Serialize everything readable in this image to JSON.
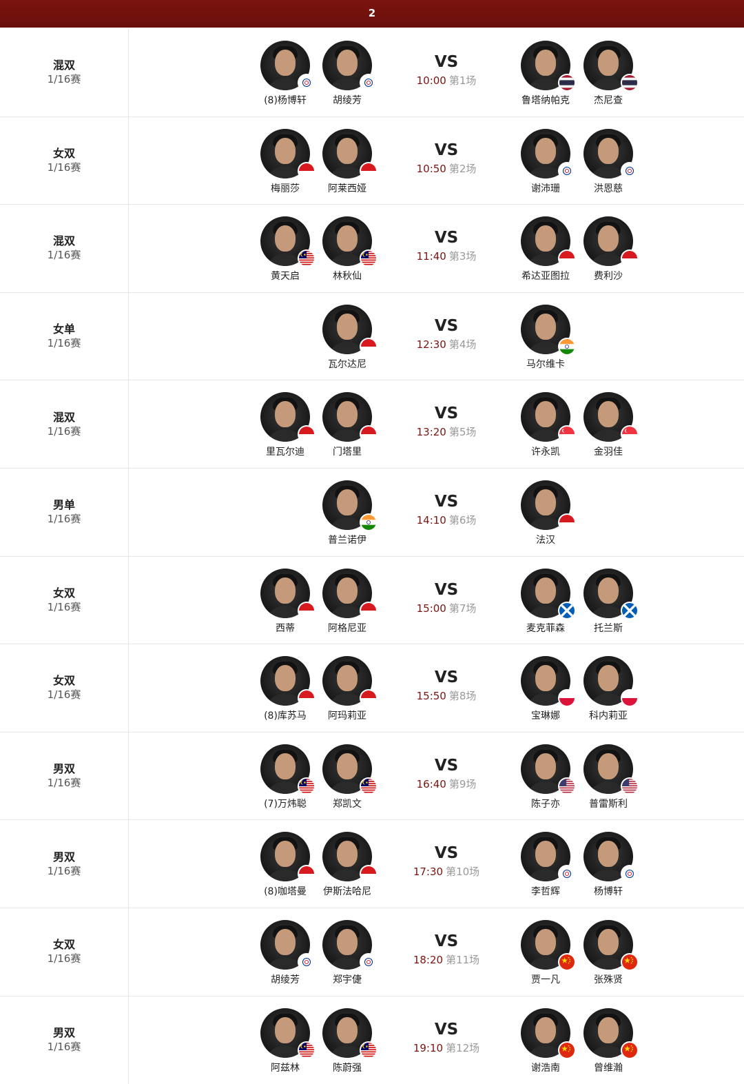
{
  "header": {
    "title": "2"
  },
  "matches": [
    {
      "event": "混双",
      "round": "1/16赛",
      "time": "10:00",
      "court": "第1场",
      "left": [
        {
          "name": "(8)杨博轩",
          "flag": "chinese-taipei"
        },
        {
          "name": "胡绫芳",
          "flag": "chinese-taipei"
        }
      ],
      "right": [
        {
          "name": "鲁塔纳帕克",
          "flag": "thailand"
        },
        {
          "name": "杰尼查",
          "flag": "thailand"
        }
      ]
    },
    {
      "event": "女双",
      "round": "1/16赛",
      "time": "10:50",
      "court": "第2场",
      "left": [
        {
          "name": "梅丽莎",
          "flag": "indonesia"
        },
        {
          "name": "阿莱西娅",
          "flag": "indonesia"
        }
      ],
      "right": [
        {
          "name": "谢沛珊",
          "flag": "chinese-taipei"
        },
        {
          "name": "洪恩慈",
          "flag": "chinese-taipei"
        }
      ]
    },
    {
      "event": "混双",
      "round": "1/16赛",
      "time": "11:40",
      "court": "第3场",
      "left": [
        {
          "name": "黄天启",
          "flag": "malaysia"
        },
        {
          "name": "林秋仙",
          "flag": "malaysia"
        }
      ],
      "right": [
        {
          "name": "希达亚图拉",
          "flag": "indonesia"
        },
        {
          "name": "费利沙",
          "flag": "indonesia"
        }
      ]
    },
    {
      "event": "女单",
      "round": "1/16赛",
      "time": "12:30",
      "court": "第4场",
      "left": [
        {
          "name": "瓦尔达尼",
          "flag": "indonesia"
        }
      ],
      "right": [
        {
          "name": "马尔维卡",
          "flag": "india"
        }
      ]
    },
    {
      "event": "混双",
      "round": "1/16赛",
      "time": "13:20",
      "court": "第5场",
      "left": [
        {
          "name": "里瓦尔迪",
          "flag": "indonesia"
        },
        {
          "name": "门塔里",
          "flag": "indonesia"
        }
      ],
      "right": [
        {
          "name": "许永凯",
          "flag": "singapore"
        },
        {
          "name": "金羽佳",
          "flag": "singapore"
        }
      ]
    },
    {
      "event": "男单",
      "round": "1/16赛",
      "time": "14:10",
      "court": "第6场",
      "left": [
        {
          "name": "普兰诺伊",
          "flag": "india"
        }
      ],
      "right": [
        {
          "name": "法汉",
          "flag": "indonesia"
        }
      ]
    },
    {
      "event": "女双",
      "round": "1/16赛",
      "time": "15:00",
      "court": "第7场",
      "left": [
        {
          "name": "西蒂",
          "flag": "indonesia"
        },
        {
          "name": "阿格尼亚",
          "flag": "indonesia"
        }
      ],
      "right": [
        {
          "name": "麦克菲森",
          "flag": "scotland"
        },
        {
          "name": "托兰斯",
          "flag": "scotland"
        }
      ]
    },
    {
      "event": "女双",
      "round": "1/16赛",
      "time": "15:50",
      "court": "第8场",
      "left": [
        {
          "name": "(8)库苏马",
          "flag": "indonesia"
        },
        {
          "name": "阿玛莉亚",
          "flag": "indonesia"
        }
      ],
      "right": [
        {
          "name": "宝琳娜",
          "flag": "poland"
        },
        {
          "name": "科内莉亚",
          "flag": "poland"
        }
      ]
    },
    {
      "event": "男双",
      "round": "1/16赛",
      "time": "16:40",
      "court": "第9场",
      "left": [
        {
          "name": "(7)万炜聪",
          "flag": "malaysia"
        },
        {
          "name": "郑凯文",
          "flag": "malaysia"
        }
      ],
      "right": [
        {
          "name": "陈子亦",
          "flag": "usa"
        },
        {
          "name": "普雷斯利",
          "flag": "usa"
        }
      ]
    },
    {
      "event": "男双",
      "round": "1/16赛",
      "time": "17:30",
      "court": "第10场",
      "left": [
        {
          "name": "(8)咖塔曼",
          "flag": "indonesia"
        },
        {
          "name": "伊斯法哈尼",
          "flag": "indonesia"
        }
      ],
      "right": [
        {
          "name": "李哲辉",
          "flag": "chinese-taipei"
        },
        {
          "name": "杨博轩",
          "flag": "chinese-taipei"
        }
      ]
    },
    {
      "event": "女双",
      "round": "1/16赛",
      "time": "18:20",
      "court": "第11场",
      "left": [
        {
          "name": "胡绫芳",
          "flag": "chinese-taipei"
        },
        {
          "name": "郑宇倢",
          "flag": "chinese-taipei"
        }
      ],
      "right": [
        {
          "name": "贾一凡",
          "flag": "china"
        },
        {
          "name": "张殊贤",
          "flag": "china"
        }
      ]
    },
    {
      "event": "男双",
      "round": "1/16赛",
      "time": "19:10",
      "court": "第12场",
      "left": [
        {
          "name": "阿兹林",
          "flag": "malaysia"
        },
        {
          "name": "陈蔚强",
          "flag": "malaysia"
        }
      ],
      "right": [
        {
          "name": "谢浩南",
          "flag": "china"
        },
        {
          "name": "曾维瀚",
          "flag": "china"
        }
      ]
    }
  ],
  "vs_label": "VS",
  "flag_colors": {
    "indonesia": [
      "#d71920",
      "#ffffff"
    ],
    "malaysia": [
      "#cc0001",
      "#ffffff",
      "#010066",
      "#ffcc00"
    ],
    "thailand": [
      "#a51931",
      "#f4f5f8",
      "#2d2a4a"
    ],
    "singapore": [
      "#ef3340",
      "#ffffff"
    ],
    "india": [
      "#ff9933",
      "#ffffff",
      "#138808",
      "#000080"
    ],
    "scotland": [
      "#005eb8",
      "#ffffff"
    ],
    "poland": [
      "#ffffff",
      "#dc143c"
    ],
    "usa": [
      "#b22234",
      "#ffffff",
      "#3c3b6e"
    ],
    "china": [
      "#de2910",
      "#ffde00"
    ],
    "chinese-taipei": [
      "#ffffff",
      "#0033a0",
      "#d61f26"
    ]
  }
}
